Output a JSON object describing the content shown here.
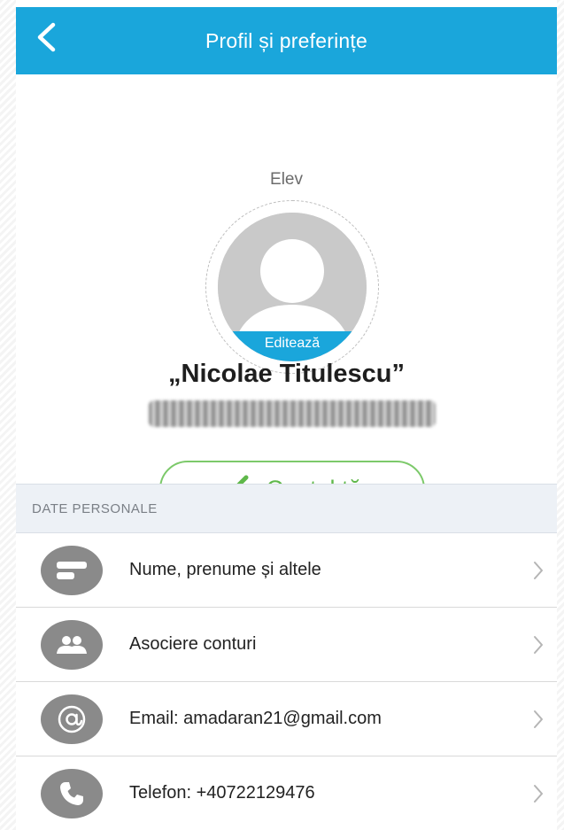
{
  "header": {
    "title": "Profil și preferințe"
  },
  "profile": {
    "role": "Elev",
    "edit_label": "Editează",
    "school": "„Nicolae Titulescu”"
  },
  "account_button": {
    "label": "Contul tău"
  },
  "personal": {
    "section_title": "DATE PERSONALE",
    "items": [
      {
        "label": "Nume, prenume și altele",
        "icon": "id-card-icon"
      },
      {
        "label": "Asociere conturi",
        "icon": "users-icon"
      },
      {
        "label": "Email: amadaran21@gmail.com",
        "icon": "at-icon"
      },
      {
        "label": "Telefon: +40722129476",
        "icon": "phone-icon"
      }
    ]
  },
  "colors": {
    "header": "#1aa6db",
    "accent_green": "#5fb84a",
    "icon_gray": "#8a8a8a"
  }
}
